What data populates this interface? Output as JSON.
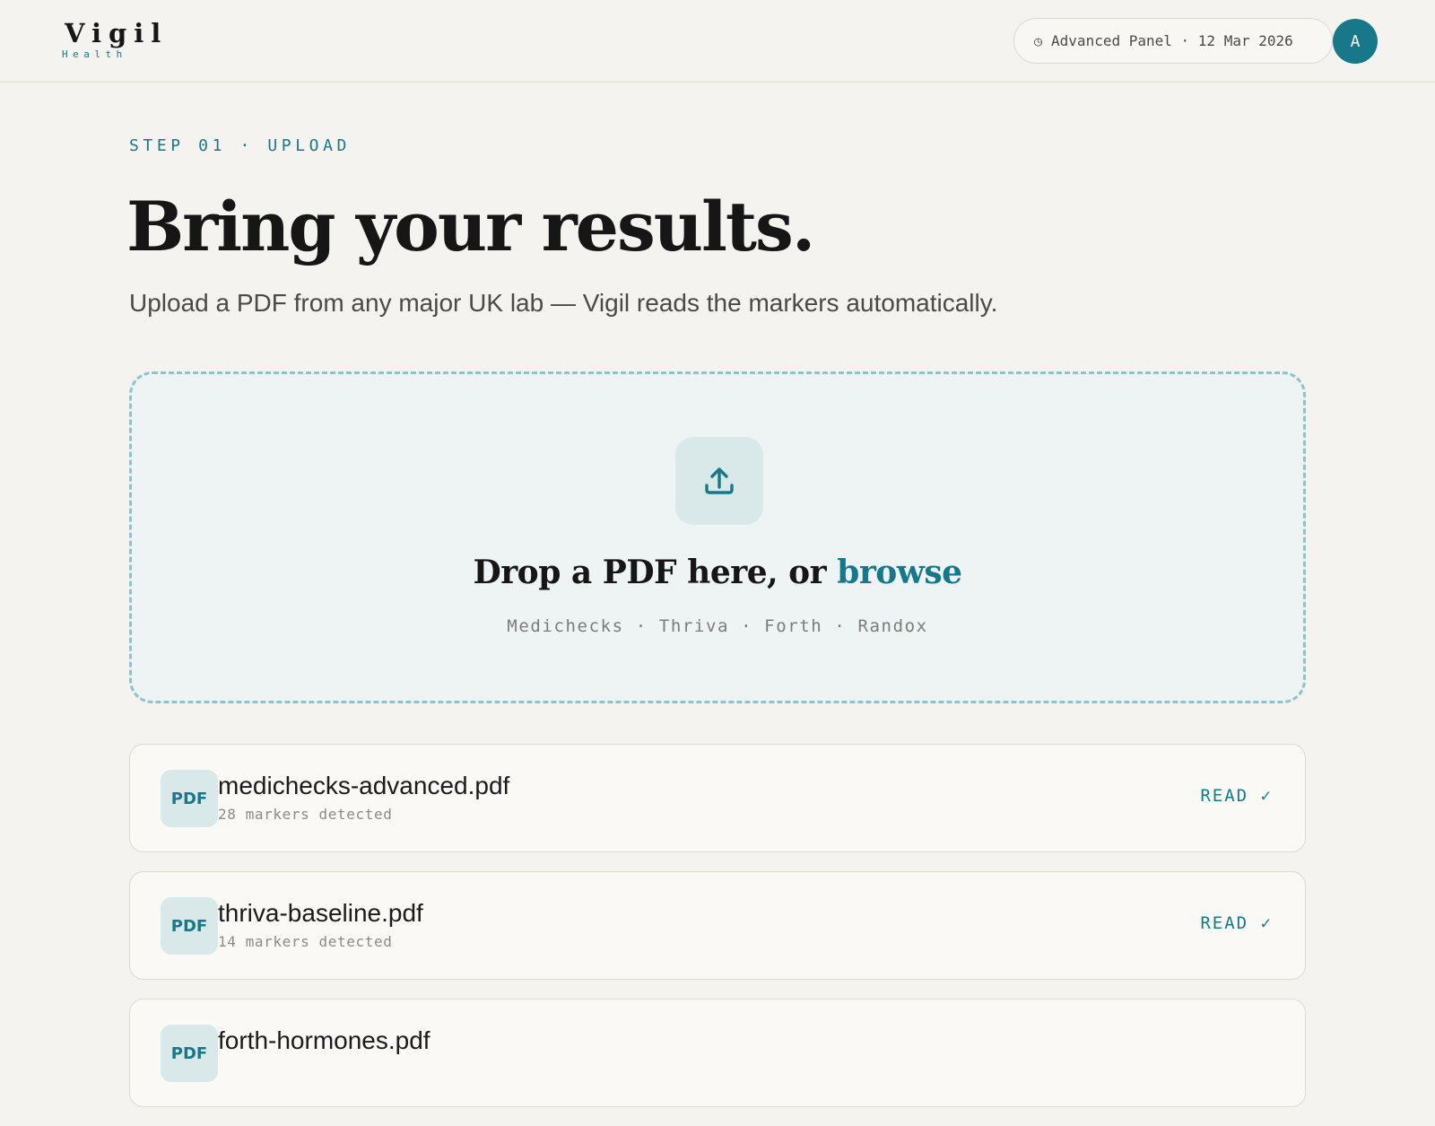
{
  "header": {
    "logo": {
      "word": "Vigil",
      "sub": "Health"
    },
    "session_icon": "clock-icon",
    "session_label": "Advanced Panel · 12 Mar 2026",
    "avatar_initial": "A"
  },
  "hero": {
    "eyebrow": "STEP 01 · UPLOAD",
    "title": "Bring your results.",
    "subtitle": "Upload a PDF from any major UK lab — Vigil reads the markers automatically."
  },
  "dropzone": {
    "icon": "upload-icon",
    "title_prefix": "Drop a PDF here, or ",
    "browse_label": "browse",
    "labs": "Medichecks · Thriva · Forth · Randox"
  },
  "files": [
    {
      "badge": "PDF",
      "name": "medichecks-advanced.pdf",
      "meta": "28 markers detected",
      "status": "READ ✓"
    },
    {
      "badge": "PDF",
      "name": "thriva-baseline.pdf",
      "meta": "14 markers detected",
      "status": "READ ✓"
    },
    {
      "badge": "PDF",
      "name": "forth-hormones.pdf",
      "meta": "",
      "status": ""
    }
  ],
  "colors": {
    "accent": "#17788a",
    "background": "#f4f3ef",
    "dropzone_fill": "#edf4f3",
    "dropzone_border": "#8fc3cc",
    "badge_fill": "#d9e8e8"
  }
}
